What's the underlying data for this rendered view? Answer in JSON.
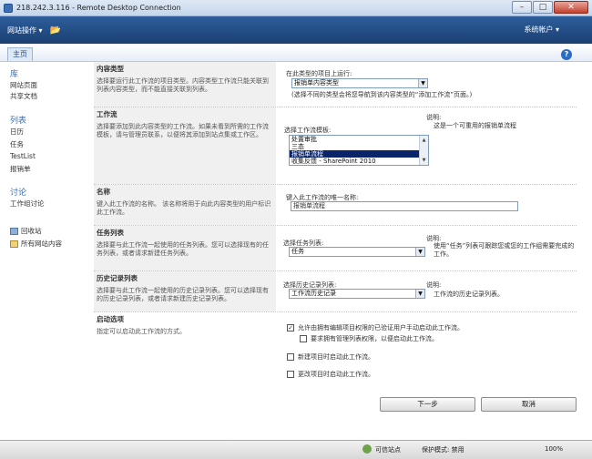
{
  "window": {
    "title": "218.242.3.116 - Remote Desktop Connection",
    "minimize": "–",
    "maximize": "□",
    "close": "✕"
  },
  "ribbon": {
    "site_actions": "网站操作 ▾",
    "account": "系统帐户 ▾"
  },
  "tabs": {
    "home": "主页",
    "help": "?"
  },
  "nav": {
    "library_heading": "库",
    "library_items": [
      "网站页面",
      "共享文档"
    ],
    "lists_heading": "列表",
    "lists_items": [
      "日历",
      "任务",
      "TestList",
      "报销单"
    ],
    "discussions_heading": "讨论",
    "discussions_items": [
      "工作组讨论"
    ],
    "recycle_bin": "回收站",
    "all_site_content": "所有网站内容"
  },
  "sections": {
    "content_type": {
      "title": "内容类型",
      "desc": "选择要运行此工作流的项目类型。内容类型工作流只能关联到列表内容类型，而不能直接关联到列表。",
      "label": "在此类型的项目上运行:",
      "value": "报销单内容类型",
      "note": "(选择不同的类型会将您导航到该内容类型的“添加工作流”页面。)"
    },
    "workflow": {
      "title": "工作流",
      "desc": "选择要添加到此内容类型的工作流。如果未看到所需的工作流模板，请与管理员联系，以便将其添加到站点集或工作区。",
      "label": "选择工作流模板:",
      "options": [
        "处置审批",
        "三态",
        "报销单流程",
        "收集反馈 - SharePoint 2010"
      ],
      "selected_index": 2,
      "desc_label": "说明:",
      "desc_value": "这是一个可重用的报销单流程"
    },
    "name": {
      "title": "名称",
      "desc": "键入此工作流的名称。 该名称将用于向此内容类型的用户标识此工作流。",
      "label": "键入此工作流的唯一名称:",
      "value": "报销单流程"
    },
    "task_list": {
      "title": "任务列表",
      "desc": "选择要与此工作流一起使用的任务列表。您可以选择现有的任务列表，或者请求新建任务列表。",
      "label": "选择任务列表:",
      "value": "任务",
      "desc_label": "说明:",
      "desc_value": "使用“任务”列表可跟踪您或您的工作组需要完成的工作。"
    },
    "history_list": {
      "title": "历史记录列表",
      "desc": "选择要与此工作流一起使用的历史记录列表。您可以选择现有的历史记录列表，或者请求新建历史记录列表。",
      "label": "选择历史记录列表:",
      "value": "工作流历史记录",
      "desc_label": "说明:",
      "desc_value": "工作流的历史记录列表。"
    },
    "start_options": {
      "title": "启动选项",
      "desc": "指定可以启动此工作流的方式。",
      "opt_manual": "允许由拥有编辑项目权限的已验证用户手动启动此工作流。",
      "opt_manage": "要求拥有管理列表权限，以便启动此工作流。",
      "opt_create": "新建项目时启动此工作流。",
      "opt_change": "更改项目时启动此工作流。"
    }
  },
  "buttons": {
    "next": "下一步",
    "cancel": "取消"
  },
  "status": {
    "trusted": "可信站点",
    "protected_mode": "保护模式: 禁用",
    "zoom": "100%"
  }
}
